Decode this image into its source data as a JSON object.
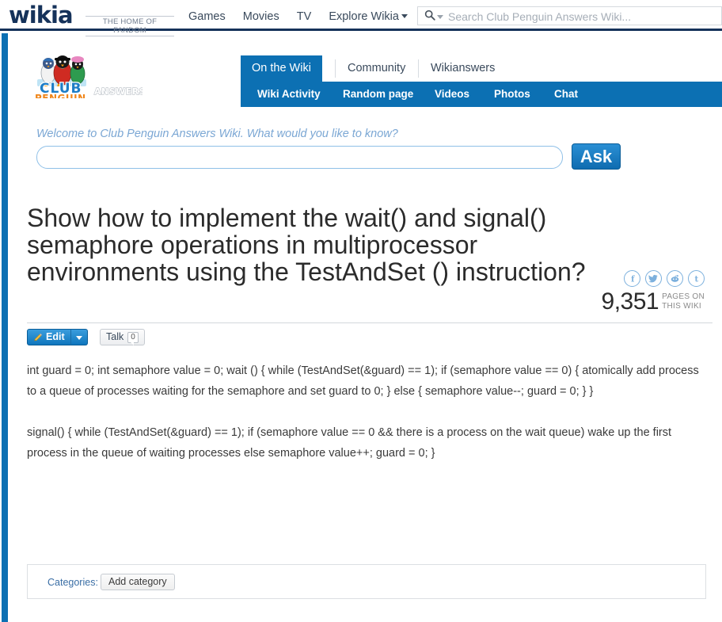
{
  "globalnav": {
    "brand": "wikia",
    "tagline": "THE HOME OF FANDOM",
    "links": [
      {
        "label": "Games"
      },
      {
        "label": "Movies"
      },
      {
        "label": "TV"
      },
      {
        "label": "Explore Wikia"
      }
    ],
    "search": {
      "placeholder": "Search Club Penguin Answers Wiki...",
      "value": "",
      "icon": "search-icon"
    }
  },
  "wiki": {
    "logo_alt": "Club Penguin Answers",
    "logo_text_top": "CLUB",
    "logo_text_bottom": "PENGUIN",
    "logo_text_suffix": "ANSWERS"
  },
  "nav": {
    "tabs": [
      {
        "label": "On the Wiki",
        "active": true
      },
      {
        "label": "Community",
        "active": false
      },
      {
        "label": "Wikianswers",
        "active": false
      }
    ],
    "subnav": [
      {
        "label": "Wiki Activity"
      },
      {
        "label": "Random page"
      },
      {
        "label": "Videos"
      },
      {
        "label": "Photos"
      },
      {
        "label": "Chat"
      }
    ]
  },
  "ask": {
    "prompt": "Welcome to Club Penguin Answers Wiki. What would you like to know?",
    "input_value": "",
    "input_placeholder": "",
    "button_label": "Ask"
  },
  "article": {
    "title": "Show how to implement the wait() and signal() semaphore operations in multiprocessor environments using the TestAndSet () instruction?",
    "paragraphs": [
      "int guard = 0; int semaphore value = 0; wait () { while (TestAndSet(&guard) == 1); if (semaphore value == 0) { atomically add process to a queue of processes waiting for the semaphore and set guard to 0; } else { semaphore value--; guard = 0; } }",
      "signal() { while (TestAndSet(&guard) == 1); if (semaphore value == 0 && there is a process on the wait queue) wake up the first process in the queue of waiting processes else semaphore value++; guard = 0; }"
    ]
  },
  "stats": {
    "pages_count": "9,351",
    "pages_label_line1": "PAGES ON",
    "pages_label_line2": "THIS WIKI"
  },
  "social": [
    {
      "name": "facebook-icon",
      "glyph": "f"
    },
    {
      "name": "twitter-icon",
      "glyph": "✈"
    },
    {
      "name": "reddit-icon",
      "glyph": "◉"
    },
    {
      "name": "tumblr-icon",
      "glyph": "t"
    }
  ],
  "actions": {
    "edit_label": "Edit",
    "edit_icon": "pencil-icon",
    "edit_dropdown_icon": "chevron-down-icon",
    "talk_label": "Talk",
    "talk_count": "0"
  },
  "categories": {
    "label": "Categories:",
    "add_button": "Add category"
  },
  "colors": {
    "wikia_navy": "#15325a",
    "wiki_blue": "#0c70b3",
    "link_blue": "#3a6ea5",
    "social_blue": "#7cb0dd"
  }
}
